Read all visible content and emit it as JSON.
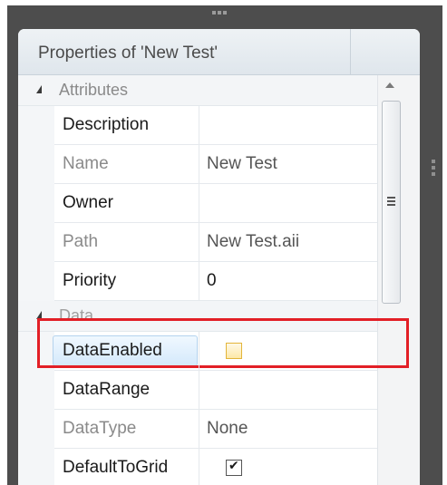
{
  "panel": {
    "title": "Properties of 'New Test'"
  },
  "categories": {
    "attributes": "Attributes",
    "data": "Data"
  },
  "rows": {
    "description": {
      "name": "Description",
      "value": ""
    },
    "name": {
      "name": "Name",
      "value": "New Test"
    },
    "owner": {
      "name": "Owner",
      "value": ""
    },
    "path": {
      "name": "Path",
      "value": "New Test.aii"
    },
    "priority": {
      "name": "Priority",
      "value": "0"
    },
    "data_enabled": {
      "name": "DataEnabled",
      "checked": false
    },
    "data_range": {
      "name": "DataRange",
      "value": ""
    },
    "data_type": {
      "name": "DataType",
      "value": "None"
    },
    "default_to_grid": {
      "name": "DefaultToGrid",
      "checked": true
    }
  },
  "colors": {
    "highlight": "#e21f26",
    "frame": "#4d4d4d",
    "selection": "#d4e9fb",
    "checkbox_hover": "#fde9a9"
  },
  "icons": {
    "collapse": "triangle-collapse-icon",
    "scroll_up": "chevron-up-icon",
    "scroll_grip": "scroll-grip-icon"
  }
}
